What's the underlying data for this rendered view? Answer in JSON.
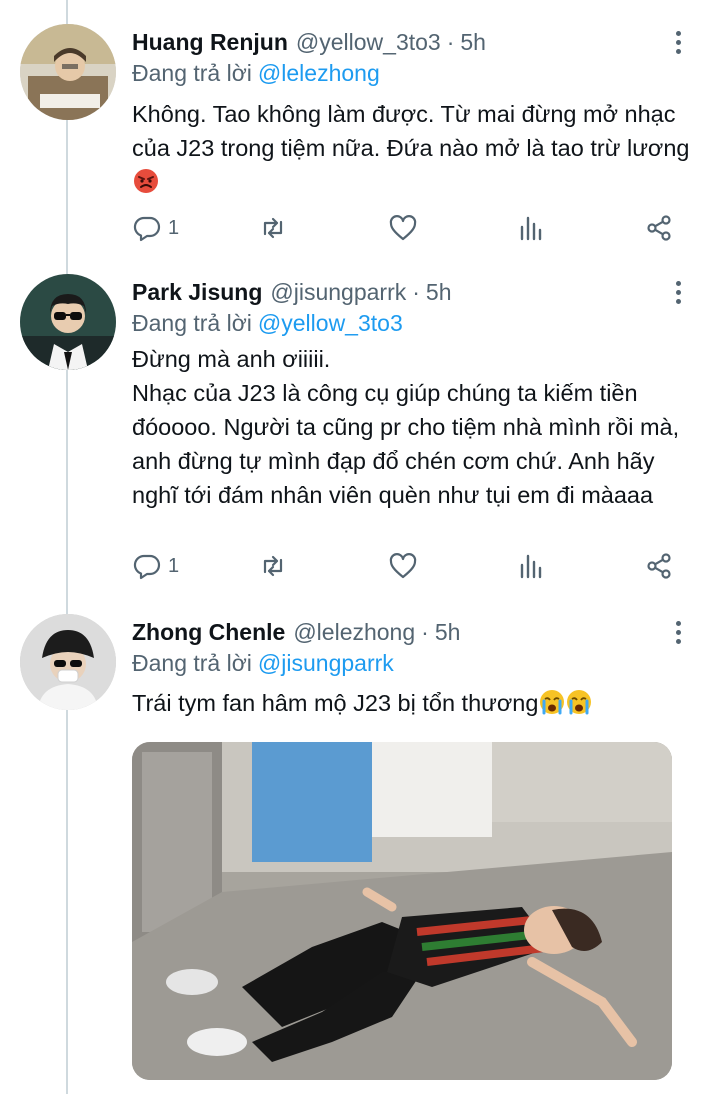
{
  "colors": {
    "accent": "#1d9bf0",
    "secondary_text": "#536471",
    "primary_text": "#0f1419",
    "thread_line": "#cfd9de"
  },
  "tweets": [
    {
      "name": "Huang Renjun",
      "handle": "@yellow_3to3",
      "time": "5h",
      "replying_label": "Đang trả lời",
      "replying_to": "@lelezhong",
      "text": "Không. Tao không làm được. Từ mai đừng mở nhạc của J23 trong tiệm nữa. Đứa nào mở là tao trừ lương",
      "emoji": "angry-face-icon",
      "reply_count": "1",
      "avatar_icon": "avatar-photo"
    },
    {
      "name": "Park Jisung",
      "handle": "@jisungparrk",
      "time": "5h",
      "replying_label": "Đang trả lời",
      "replying_to": "@yellow_3to3",
      "text": "Đừng mà anh ơiiiii.\nNhạc của J23 là công cụ giúp chúng ta kiếm tiền đóoooo. Người ta cũng pr cho tiệm nhà mình rồi mà, anh đừng tự mình đạp đổ chén cơm chứ. Anh hãy nghĩ tới đám nhân viên quèn như tụi em đi màaaa",
      "reply_count": "1",
      "avatar_icon": "avatar-photo"
    },
    {
      "name": "Zhong Chenle",
      "handle": "@lelezhong",
      "time": "5h",
      "replying_label": "Đang trả lời",
      "replying_to": "@jisungparrk",
      "text": "Trái tym fan hâm mộ J23 bị tổn thương",
      "emoji": "crying-face-icon",
      "avatar_icon": "avatar-photo",
      "media": "photo-person-lying-on-floor"
    }
  ],
  "icons": {
    "reply": "reply-icon",
    "retweet": "retweet-icon",
    "like": "heart-icon",
    "stats": "bar-chart-icon",
    "share": "share-icon",
    "more": "more-vertical-icon"
  }
}
